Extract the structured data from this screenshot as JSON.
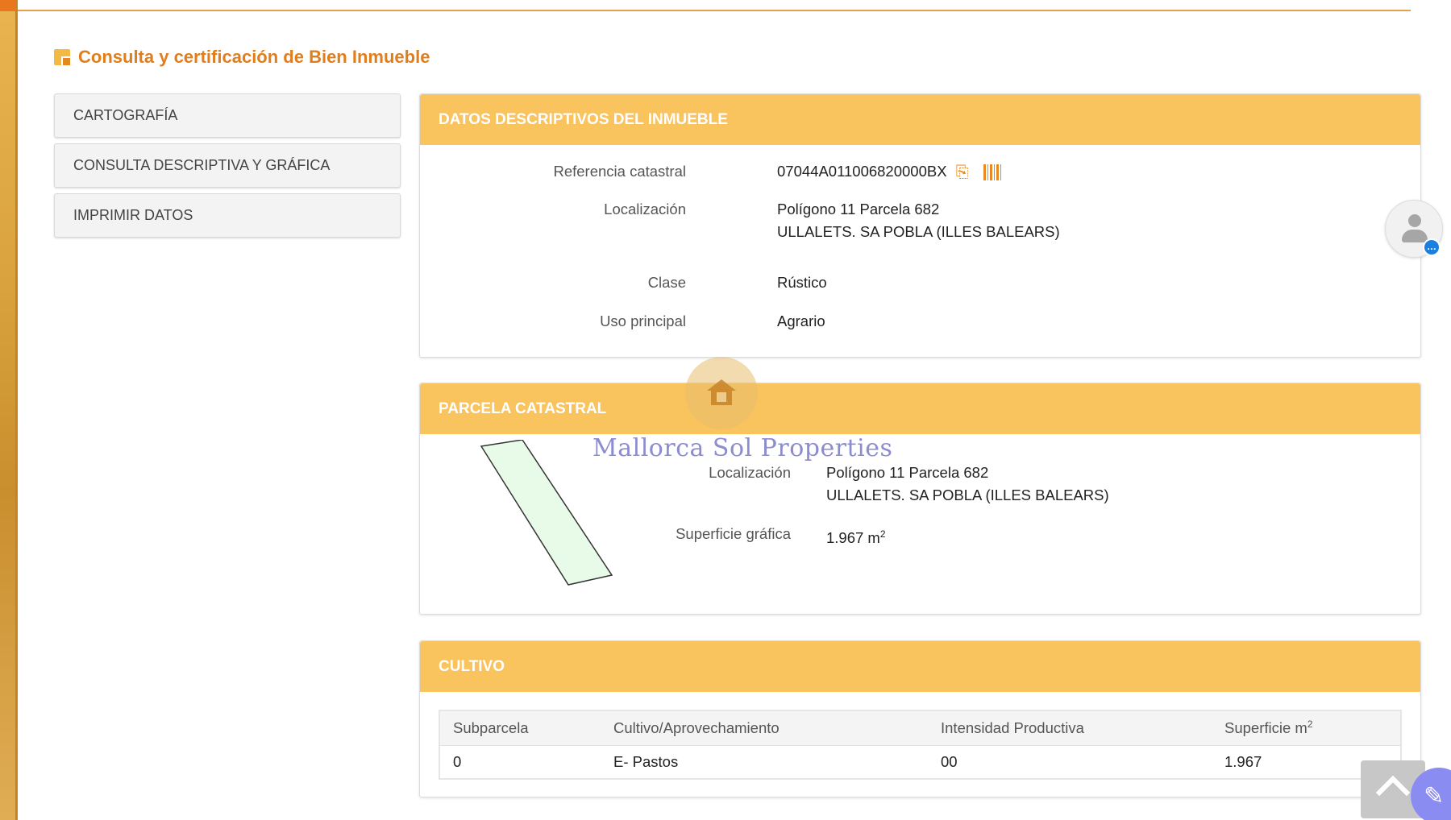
{
  "page": {
    "title": "Consulta y certificación de Bien Inmueble"
  },
  "menu": {
    "items": [
      {
        "label": "CARTOGRAFÍA"
      },
      {
        "label": "CONSULTA DESCRIPTIVA Y GRÁFICA"
      },
      {
        "label": "IMPRIMIR DATOS"
      }
    ]
  },
  "descriptive": {
    "header": "DATOS DESCRIPTIVOS DEL INMUEBLE",
    "ref_label": "Referencia catastral",
    "ref_value": "07044A011006820000BX",
    "loc_label": "Localización",
    "loc_line1": "Polígono 11 Parcela 682",
    "loc_line2": "ULLALETS. SA POBLA (ILLES BALEARS)",
    "clase_label": "Clase",
    "clase_value": "Rústico",
    "uso_label": "Uso principal",
    "uso_value": "Agrario"
  },
  "parcel": {
    "header": "PARCELA CATASTRAL",
    "loc_label": "Localización",
    "loc_line1": "Polígono 11 Parcela 682",
    "loc_line2": "ULLALETS. SA POBLA (ILLES BALEARS)",
    "area_label": "Superficie gráfica",
    "area_value": "1.967 m",
    "area_unit_sup": "2",
    "shape_fill": "#e8fbe8",
    "shape_stroke": "#333333"
  },
  "cultivo": {
    "header": "CULTIVO",
    "columns": [
      "Subparcela",
      "Cultivo/Aprovechamiento",
      "Intensidad Productiva",
      "Superficie m"
    ],
    "col4_sup": "2",
    "rows": [
      [
        "0",
        "E- Pastos",
        "00",
        "1.967"
      ]
    ]
  },
  "watermark": {
    "text": "Mallorca Sol Properties"
  },
  "icons": {
    "title": "document-icon",
    "copy": "copy-icon",
    "barcode": "barcode-icon",
    "avatar": "user-avatar-icon",
    "chat": "chat-icon",
    "scroll": "chevron-up-icon",
    "edit": "pencil-icon"
  },
  "colors": {
    "accent": "#e07e1c",
    "panel_header": "#f9c35e",
    "fab": "#8b8cf2"
  }
}
